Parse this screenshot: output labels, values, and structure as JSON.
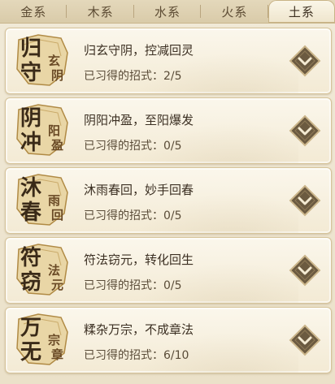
{
  "tabs": [
    {
      "label": "金系",
      "active": false
    },
    {
      "label": "木系",
      "active": false
    },
    {
      "label": "水系",
      "active": false
    },
    {
      "label": "火系",
      "active": false
    },
    {
      "label": "土系",
      "active": true
    }
  ],
  "progress_label": "已习得的招式：",
  "cards": [
    {
      "emblem_big": [
        "归",
        "守"
      ],
      "emblem_small": [
        "玄",
        "阴"
      ],
      "title": "归玄守阴，控减回灵",
      "learned": "2/5"
    },
    {
      "emblem_big": [
        "阴",
        "冲"
      ],
      "emblem_small": [
        "阳",
        "盈"
      ],
      "title": "阴阳冲盈，至阳爆发",
      "learned": "0/5"
    },
    {
      "emblem_big": [
        "沐",
        "春"
      ],
      "emblem_small": [
        "雨",
        "回"
      ],
      "title": "沐雨春回，妙手回春",
      "learned": "0/5"
    },
    {
      "emblem_big": [
        "符",
        "窃"
      ],
      "emblem_small": [
        "法",
        "元"
      ],
      "title": "符法窃元，转化回生",
      "learned": "0/5"
    },
    {
      "emblem_big": [
        "万",
        "无"
      ],
      "emblem_small": [
        "宗",
        "章"
      ],
      "title": "糅杂万宗，不成章法",
      "learned": "6/10"
    }
  ],
  "colors": {
    "accent_gold": "#b08a44",
    "button_dark": "#6b5a40",
    "text_dark": "#3b2f22"
  },
  "icons": {
    "expand": "chevron-down-icon"
  }
}
